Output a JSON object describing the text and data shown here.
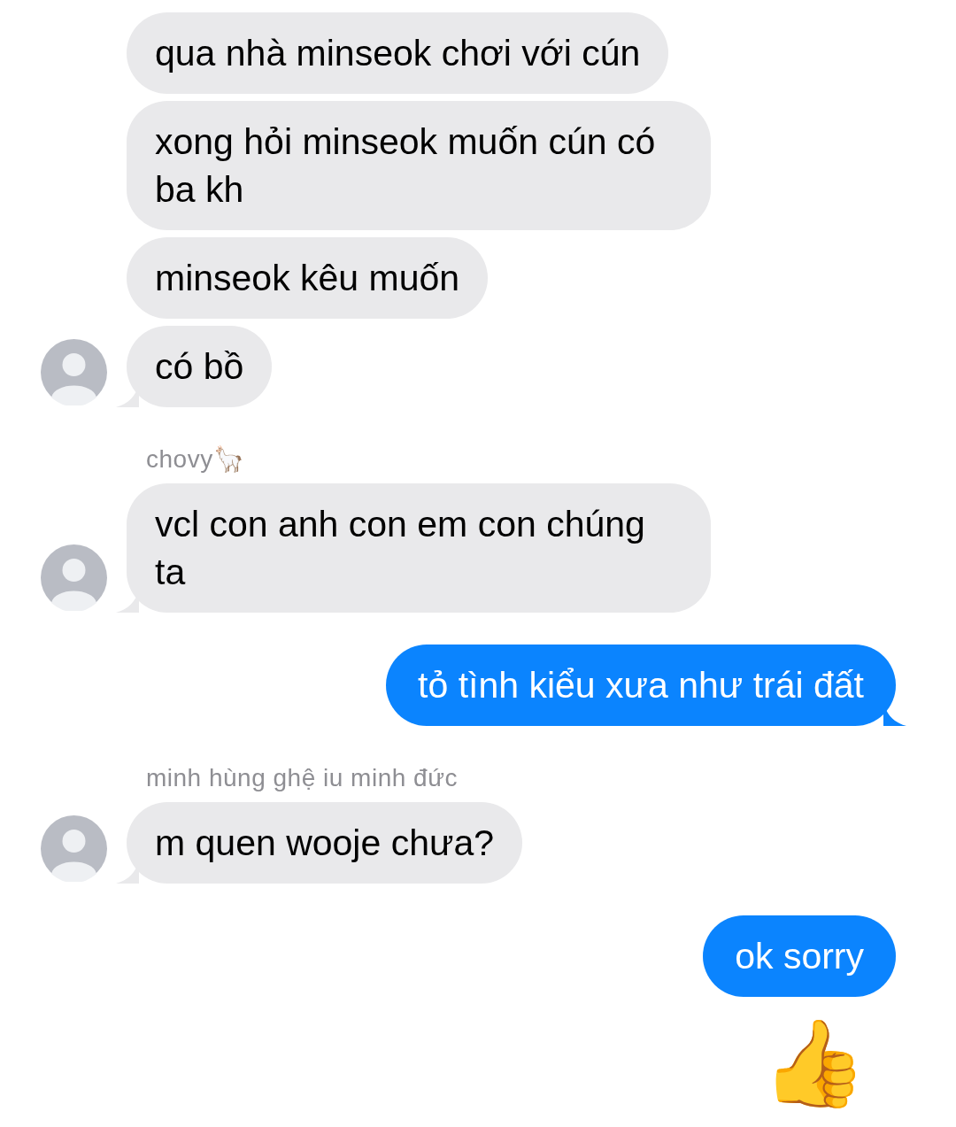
{
  "messages": [
    {
      "kind": "incoming",
      "text": "qua nhà minseok chơi với cún",
      "avatar": false,
      "tail": false
    },
    {
      "kind": "incoming",
      "text": "xong hỏi minseok muốn cún có ba kh",
      "avatar": false,
      "tail": false
    },
    {
      "kind": "incoming",
      "text": "minseok kêu muốn",
      "avatar": false,
      "tail": false
    },
    {
      "kind": "incoming",
      "text": "có bồ",
      "avatar": true,
      "tail": true
    },
    {
      "kind": "sender",
      "text": "chovy🦙"
    },
    {
      "kind": "incoming",
      "text": "vcl con anh con em con chúng ta",
      "avatar": true,
      "tail": true
    },
    {
      "kind": "outgoing",
      "text": "tỏ tình kiểu xưa như trái đất",
      "tail": true
    },
    {
      "kind": "sender",
      "text": "minh hùng ghệ iu minh đức"
    },
    {
      "kind": "incoming",
      "text": "m quen wooje chưa?",
      "avatar": true,
      "tail": true
    },
    {
      "kind": "outgoing",
      "text": "ok sorry",
      "tail": false
    },
    {
      "kind": "emoji",
      "text": "👍"
    }
  ]
}
